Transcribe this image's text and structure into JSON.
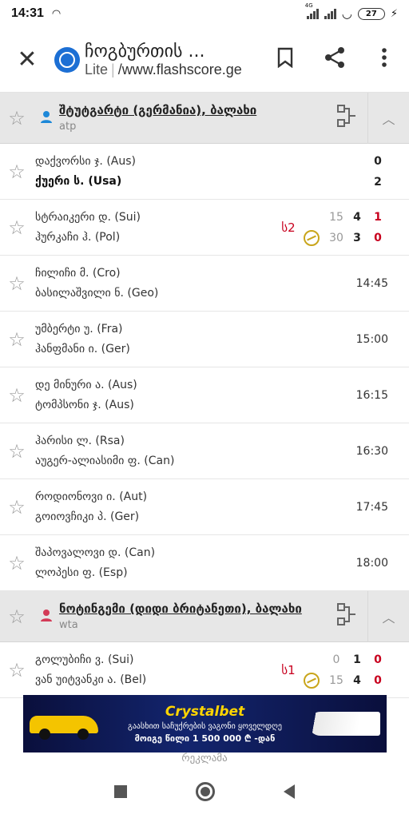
{
  "status_bar": {
    "time": "14:31",
    "network": "4G",
    "battery": "27"
  },
  "browser": {
    "page_title": "ჩოგბურთის ...",
    "lite_label": "Lite",
    "url": "/www.flashscore.ge"
  },
  "leagues": [
    {
      "name": "შტუტგარტი (გერმანია), ბალახი",
      "tour": "atp",
      "matches": [
        {
          "p1": "დაქვორსი ჯ. (Aus)",
          "p2": "ქუერი ს. (Usa)",
          "p1_win": false,
          "p2_win": true,
          "final": [
            "0",
            "2"
          ]
        },
        {
          "p1": "სტრაიკერი დ. (Sui)",
          "p2": "ჰურკაჩი ჰ. (Pol)",
          "set_tag": "ს2",
          "live": [
            {
              "game": "15",
              "set": "4",
              "total": "1"
            },
            {
              "game": "30",
              "set": "3",
              "total": "0"
            }
          ],
          "serving": 2
        },
        {
          "p1": "ჩილიჩი მ. (Cro)",
          "p2": "ბასილაშვილი ნ. (Geo)",
          "time": "14:45"
        },
        {
          "p1": "უმბერტი უ. (Fra)",
          "p2": "ჰანფმანი ი. (Ger)",
          "time": "15:00"
        },
        {
          "p1": "დე მინური ა. (Aus)",
          "p2": "ტომპსონი ჯ. (Aus)",
          "time": "16:15"
        },
        {
          "p1": "ჰარისი ლ. (Rsa)",
          "p2": "აუგერ-ალიასიმი ფ. (Can)",
          "time": "16:30"
        },
        {
          "p1": "როდიონოვი ი. (Aut)",
          "p2": "გოიოვჩიკი პ. (Ger)",
          "time": "17:45"
        },
        {
          "p1": "შაპოვალოვი დ. (Can)",
          "p2": "ლოპესი ფ. (Esp)",
          "time": "18:00"
        }
      ]
    },
    {
      "name": "ნოტინგემი (დიდი ბრიტანეთი), ბალახი",
      "tour": "wta",
      "matches": [
        {
          "p1": "გოლუბიჩი ვ. (Sui)",
          "p2": "ვან უიტვანკი ა. (Bel)",
          "set_tag": "ს1",
          "live": [
            {
              "game": "0",
              "set": "1",
              "total": "0"
            },
            {
              "game": "15",
              "set": "4",
              "total": "0"
            }
          ],
          "serving": 2
        }
      ]
    }
  ],
  "ad": {
    "brand": "Crystalbet",
    "line1": "გაასხით საჩუქრების ვაგონი ყოველდღე",
    "line2": "მოიგე წილი 1 500 000 ₾ -დან",
    "label": "რეკლამა"
  },
  "colors": {
    "header_bg": "#e7e7e7",
    "live_red": "#c8001e",
    "serve_yellow": "#c9a51b",
    "logo_blue": "#1c6fd4"
  }
}
